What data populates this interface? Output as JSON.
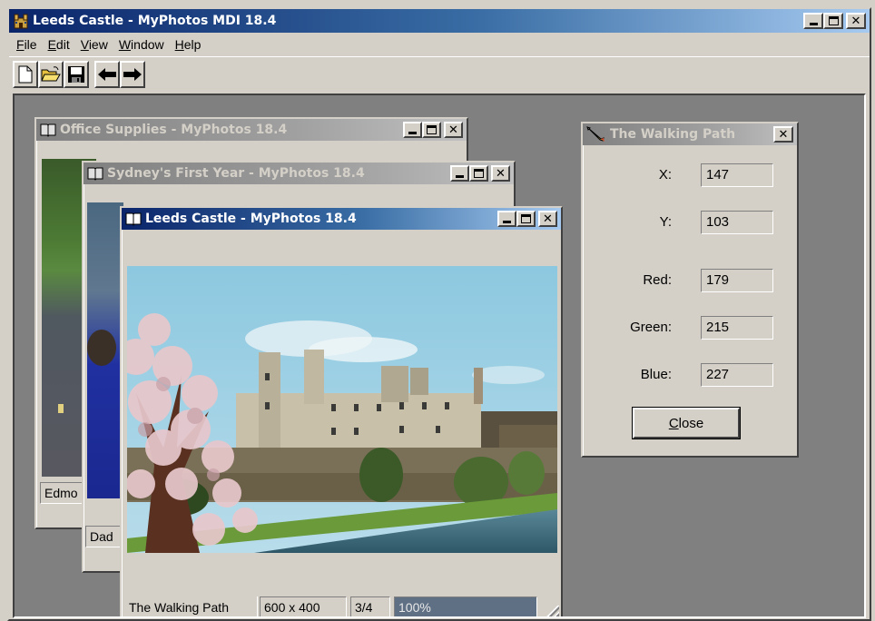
{
  "app": {
    "title": "Leeds Castle - MyPhotos MDI 18.4",
    "icon": "castle-icon"
  },
  "menu": {
    "items": [
      {
        "label": "File",
        "mnemonic": "F",
        "rest": "ile"
      },
      {
        "label": "Edit",
        "mnemonic": "E",
        "rest": "dit"
      },
      {
        "label": "View",
        "mnemonic": "V",
        "rest": "iew"
      },
      {
        "label": "Window",
        "mnemonic": "W",
        "rest": "indow"
      },
      {
        "label": "Help",
        "mnemonic": "H",
        "rest": "elp"
      }
    ]
  },
  "toolbar": {
    "buttons": [
      "new-file-icon",
      "open-folder-icon",
      "save-disk-icon",
      "arrow-left-icon",
      "arrow-right-icon"
    ]
  },
  "children": {
    "office": {
      "title": "Office Supplies - MyPhotos 18.4",
      "caption": "Edmo"
    },
    "sydney": {
      "title": "Sydney's First Year - MyPhotos 18.4",
      "caption": "Dad"
    },
    "leeds": {
      "title": "Leeds Castle - MyPhotos 18.4",
      "caption": "The Walking Path",
      "size": "600 x 400",
      "index": "3/4",
      "zoom": "100%"
    }
  },
  "pixel_dialog": {
    "title": "The Walking Path",
    "fields": [
      {
        "label": "X:",
        "value": "147"
      },
      {
        "label": "Y:",
        "value": "103"
      },
      {
        "label": "Red:",
        "value": "179"
      },
      {
        "label": "Green:",
        "value": "215"
      },
      {
        "label": "Blue:",
        "value": "227"
      }
    ],
    "close_label": "Close",
    "close_mnemonic": "C",
    "close_rest": "lose"
  },
  "colors": {
    "active_title": "#0a246a",
    "inactive_title": "#808080",
    "face": "#d4d0c8",
    "mdi_background": "#808080"
  }
}
